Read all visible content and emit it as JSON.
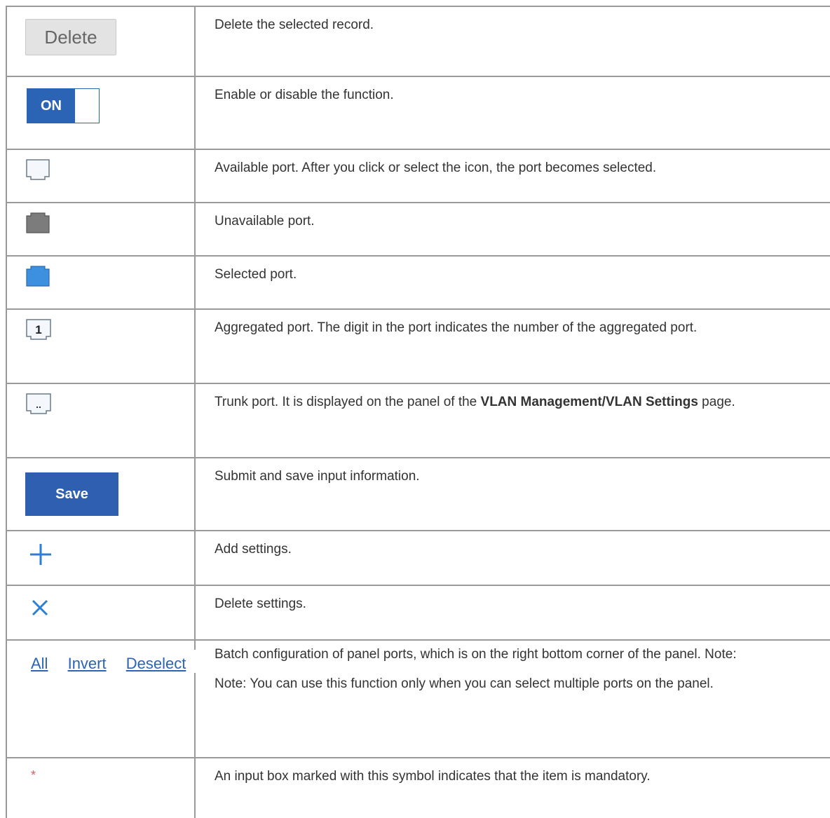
{
  "rows": [
    {
      "control": "Delete",
      "desc": "Delete the selected record."
    },
    {
      "control": "ON",
      "desc": "Enable or disable the function."
    },
    {
      "desc": "Available port. After you click or select the icon, the port becomes selected."
    },
    {
      "desc": "Unavailable port."
    },
    {
      "desc": "Selected port."
    },
    {
      "port_number": "1",
      "desc": "Aggregated port. The digit in the port indicates the number of the aggregated port."
    },
    {
      "port_mark": "..",
      "desc_before": "Trunk port. It is displayed on the panel of the ",
      "desc_bold": "VLAN Management/VLAN Settings",
      "desc_after": " page."
    },
    {
      "control": "Save",
      "desc": "Submit and save input information."
    },
    {
      "desc": "Add settings."
    },
    {
      "desc": "Delete settings."
    },
    {
      "links": [
        "All",
        "Invert",
        "Deselect"
      ],
      "desc": "Batch configuration of panel ports, which is on the right bottom corner of the panel. Note:",
      "note": "Note: You can use this function only when you can select multiple ports on the panel."
    },
    {
      "control": "*",
      "desc": "An input box marked with this symbol indicates that the item is mandatory."
    }
  ],
  "colors": {
    "accent": "#2b63b5",
    "border": "#9a9a9a",
    "required": "#e05a5a"
  },
  "icons": [
    "port-available-icon",
    "port-unavailable-icon",
    "port-selected-icon",
    "port-aggregated-icon",
    "port-trunk-icon",
    "plus-icon",
    "close-icon"
  ]
}
